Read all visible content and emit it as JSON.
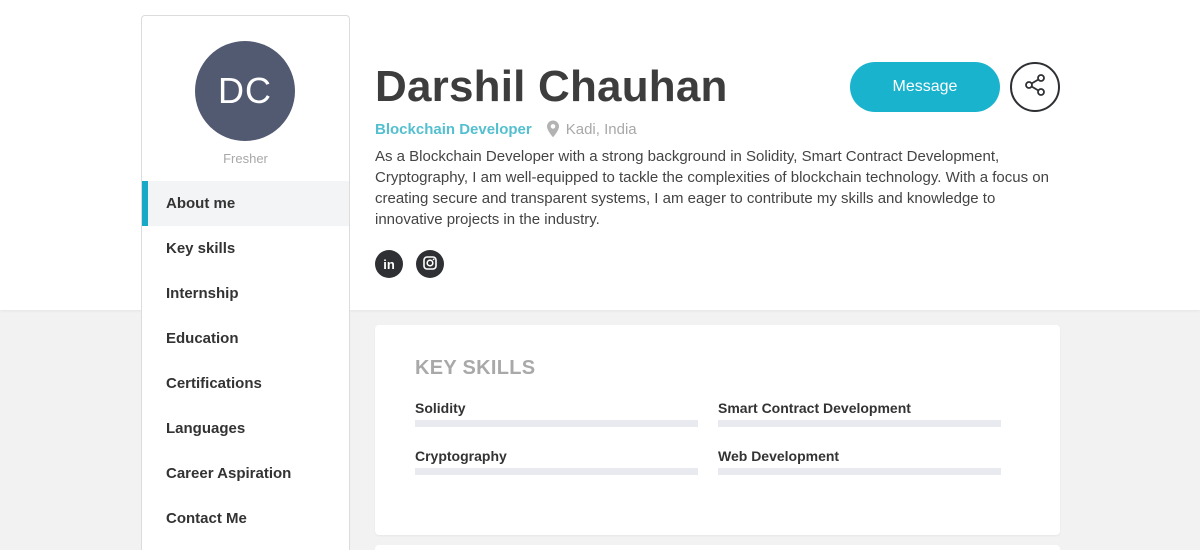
{
  "profile": {
    "initials": "DC",
    "status": "Fresher",
    "name": "Darshil Chauhan",
    "role": "Blockchain Developer",
    "location": "Kadi, India",
    "bio": "As a Blockchain Developer with a strong background in Solidity, Smart Contract Development, Cryptography, I am well-equipped to tackle the complexities of blockchain technology. With a focus on creating secure and transparent systems, I am eager to contribute my skills and knowledge to innovative projects in the industry."
  },
  "colors": {
    "accent": "#19b3ce",
    "avatar_bg": "#525a72",
    "role_text": "#53bfcf"
  },
  "actions": {
    "message_label": "Message",
    "share_icon": "share-icon"
  },
  "social": {
    "linkedin_glyph": "in",
    "instagram_icon": "instagram-icon"
  },
  "sidebar": {
    "items": [
      {
        "label": "About me",
        "active": true
      },
      {
        "label": "Key skills",
        "active": false
      },
      {
        "label": "Internship",
        "active": false
      },
      {
        "label": "Education",
        "active": false
      },
      {
        "label": "Certifications",
        "active": false
      },
      {
        "label": "Languages",
        "active": false
      },
      {
        "label": "Career Aspiration",
        "active": false
      },
      {
        "label": "Contact Me",
        "active": false
      }
    ]
  },
  "skills": {
    "title": "KEY SKILLS",
    "items": [
      {
        "name": "Solidity"
      },
      {
        "name": "Smart Contract Development"
      },
      {
        "name": "Cryptography"
      },
      {
        "name": "Web Development"
      }
    ]
  }
}
